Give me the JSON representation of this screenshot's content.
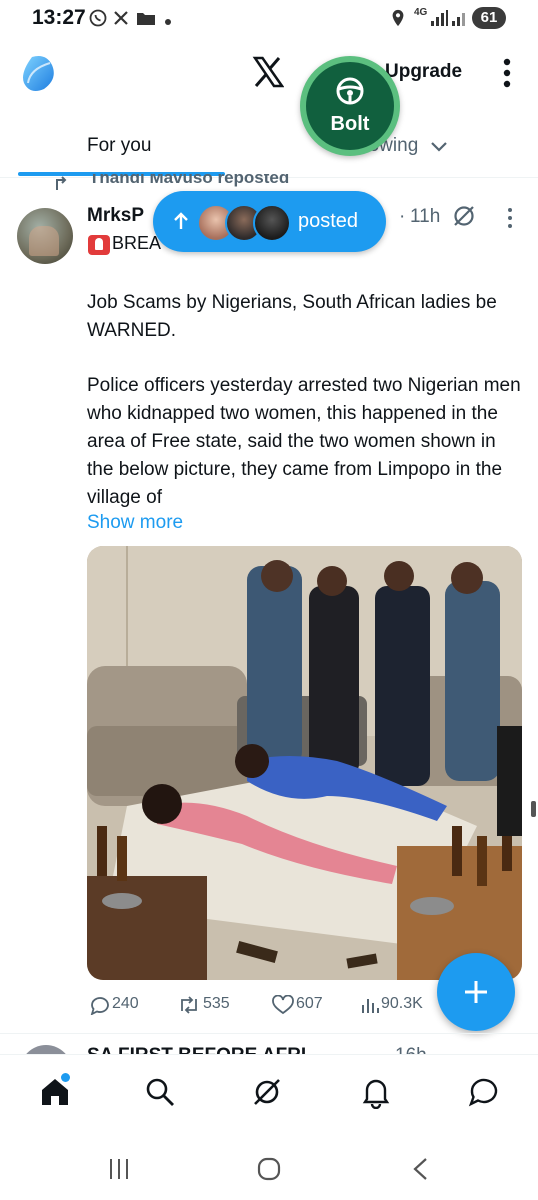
{
  "status_bar": {
    "time": "13:27",
    "network": "4G",
    "battery": "61"
  },
  "header": {
    "upgrade_label": "Upgrade",
    "tabs": [
      {
        "label": "For you",
        "selected": true
      },
      {
        "label": "Following",
        "selected": false
      }
    ]
  },
  "bolt_bubble": {
    "label": "Bolt"
  },
  "posted_pill": {
    "label": "posted"
  },
  "tweet": {
    "repost_text": "Thandi Mavuso reposted",
    "author_name": "MrksP",
    "breaking_text": "BREA",
    "time": "11h",
    "body_paragraph_1": "Job Scams by Nigerians, South African ladies be WARNED.",
    "body_paragraph_2": "Police officers yesterday arrested two Nigerian men who kidnapped two women, this happened in the area of Free state, said the two women shown in the below picture, they came from Limpopo in the village of",
    "show_more": "Show more",
    "stats": {
      "replies": "240",
      "reposts": "535",
      "likes": "607",
      "views": "90.3K"
    }
  },
  "next_tweet": {
    "author_name": "SA FIRST BEFORE AFRI",
    "time": "16h"
  },
  "colors": {
    "accent": "#1d9bf0",
    "bolt_green": "#11603e",
    "muted_text": "#536471"
  }
}
